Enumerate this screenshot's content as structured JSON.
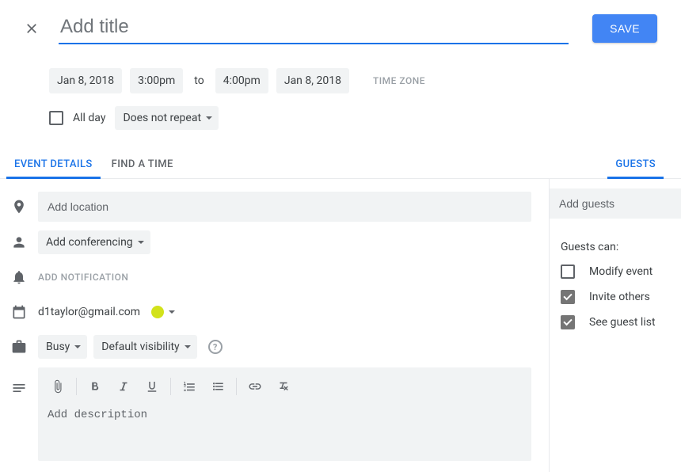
{
  "header": {
    "title_placeholder": "Add title",
    "save_label": "SAVE"
  },
  "datetime": {
    "start_date": "Jan 8, 2018",
    "start_time": "3:00pm",
    "to": "to",
    "end_time": "4:00pm",
    "end_date": "Jan 8, 2018",
    "tz_label": "TIME ZONE",
    "all_day_label": "All day",
    "repeat_label": "Does not repeat"
  },
  "tabs": {
    "details": "EVENT DETAILS",
    "find_time": "FIND A TIME",
    "guests": "GUESTS"
  },
  "details": {
    "location_placeholder": "Add location",
    "conferencing_label": "Add conferencing",
    "notification_label": "ADD NOTIFICATION",
    "organizer": "d1taylor@gmail.com",
    "busy_label": "Busy",
    "visibility_label": "Default visibility",
    "help": "?",
    "description_placeholder": "Add description",
    "color": "#d2e21b"
  },
  "guests": {
    "add_placeholder": "Add guests",
    "can_title": "Guests can:",
    "perms": [
      {
        "label": "Modify event",
        "checked": false
      },
      {
        "label": "Invite others",
        "checked": true
      },
      {
        "label": "See guest list",
        "checked": true
      }
    ]
  }
}
